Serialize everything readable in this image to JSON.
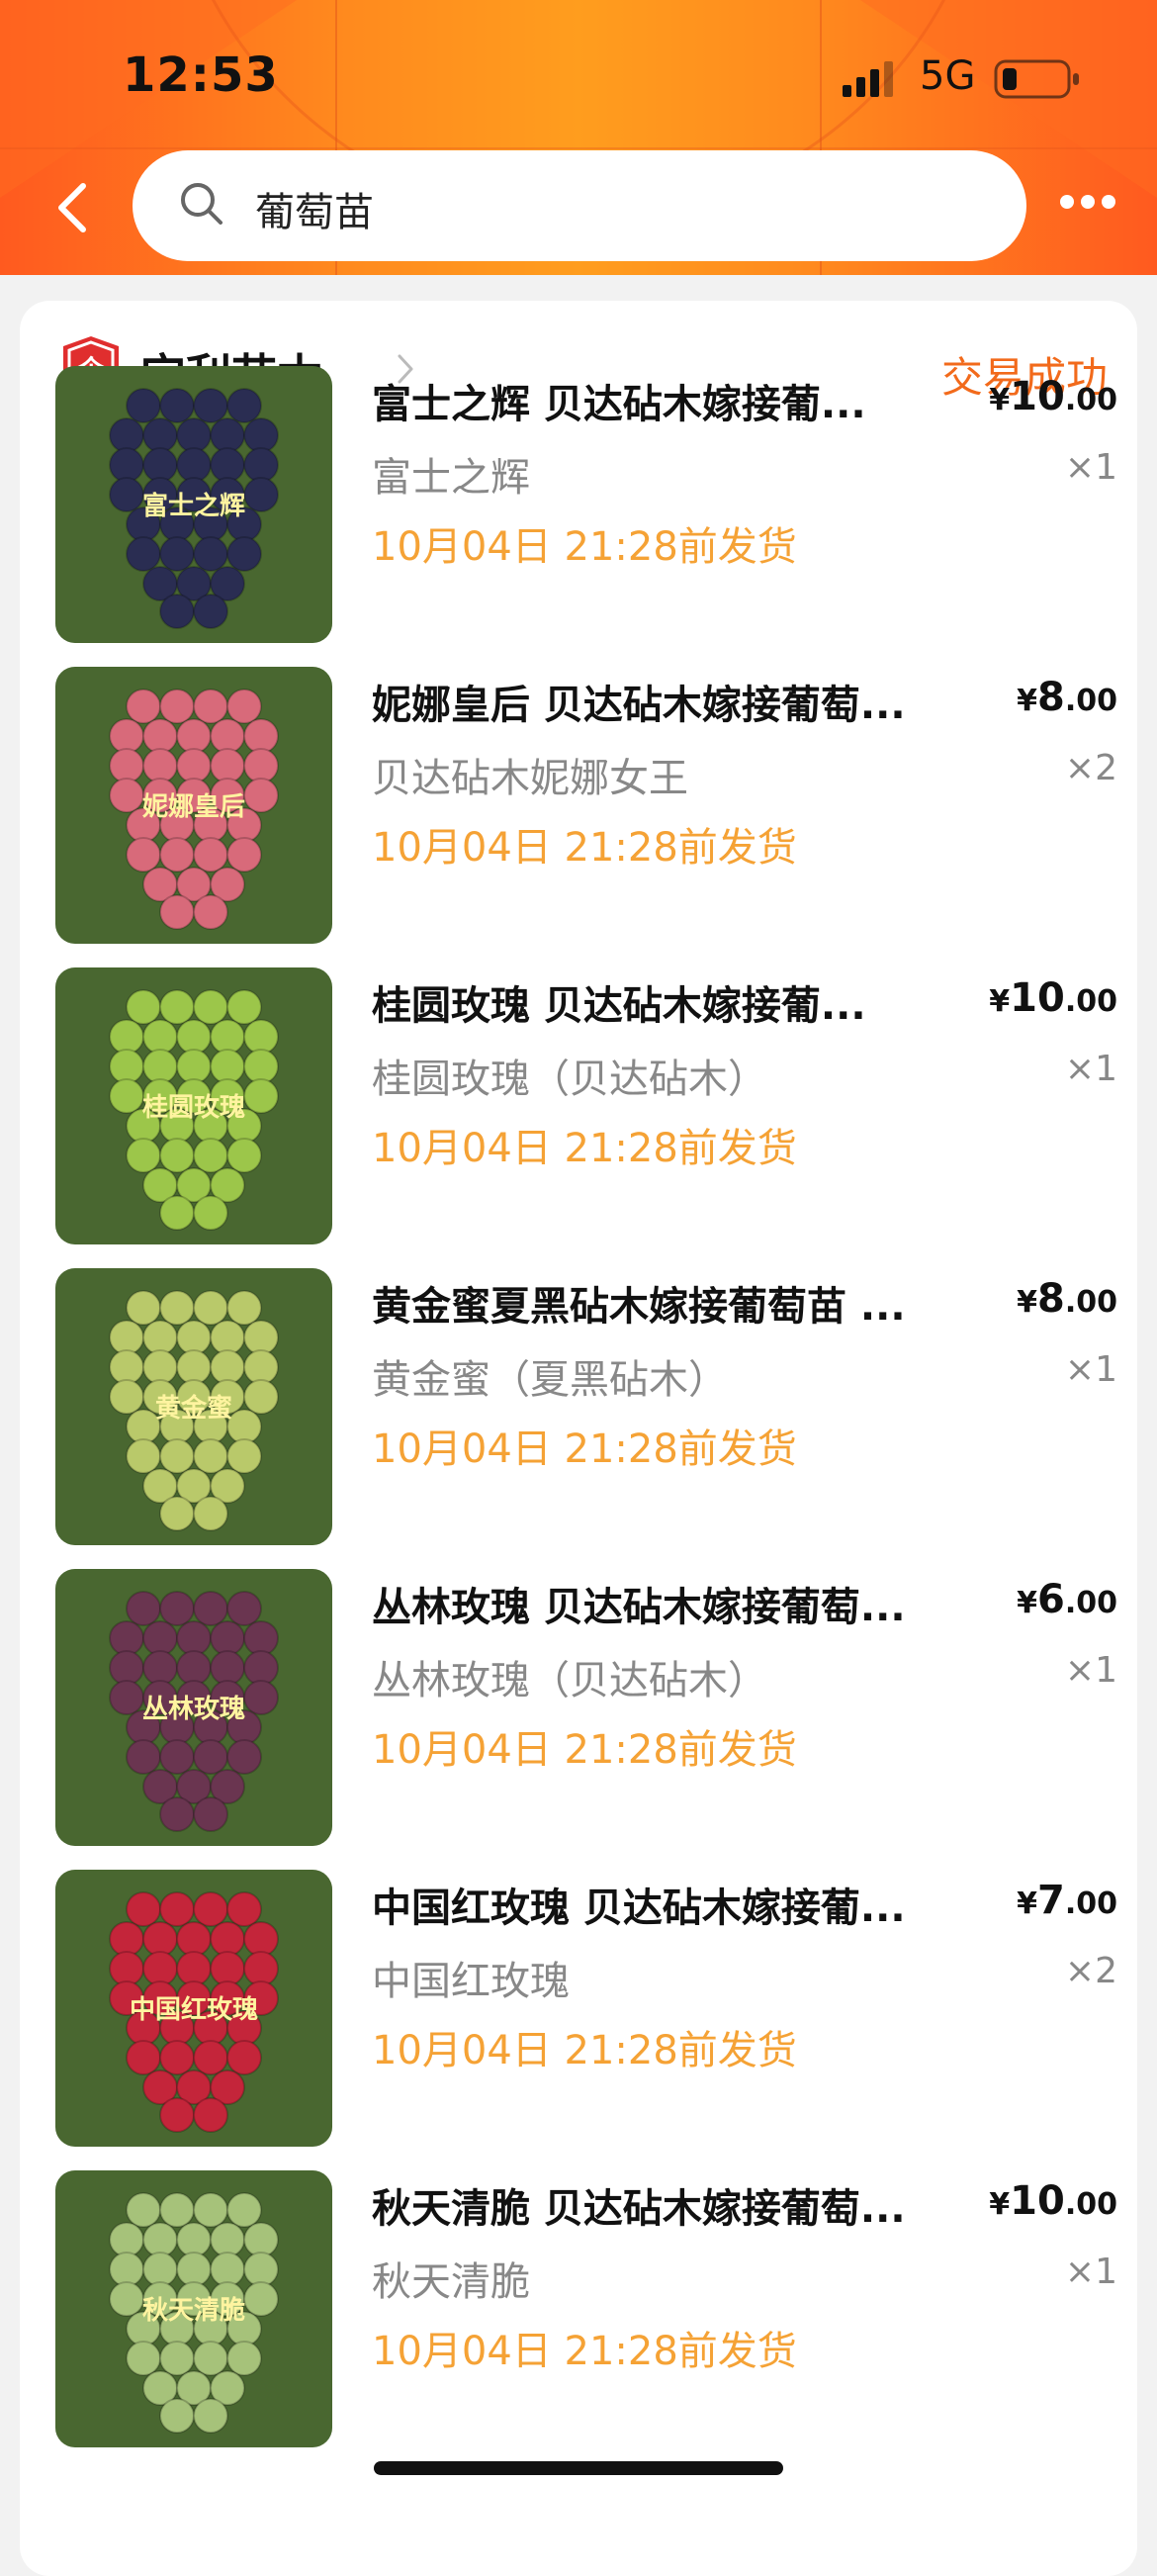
{
  "status_bar": {
    "time": "12:53",
    "network": "5G"
  },
  "search": {
    "query": "葡萄苗"
  },
  "shop": {
    "name": "宝利苗木",
    "order_status": "交易成功",
    "badge_text": "企"
  },
  "items": [
    {
      "title": "富士之辉  贝达砧木嫁接葡...",
      "sku": "富士之辉",
      "price_currency": "¥",
      "price_int": "10",
      "price_dec": ".00",
      "qty": "×1",
      "ship": "10月04日 21:28前发货",
      "image_label": "富士之辉",
      "image_color": "#2a2d52"
    },
    {
      "title": "妮娜皇后 贝达砧木嫁接葡萄...",
      "sku": "贝达砧木妮娜女王",
      "price_currency": "¥",
      "price_int": "8",
      "price_dec": ".00",
      "qty": "×2",
      "ship": "10月04日 21:28前发货",
      "image_label": "妮娜皇后",
      "image_color": "#d86a7a"
    },
    {
      "title": "桂圆玫瑰  贝达砧木嫁接葡...",
      "sku": "桂圆玫瑰（贝达砧木）",
      "price_currency": "¥",
      "price_int": "10",
      "price_dec": ".00",
      "qty": "×1",
      "ship": "10月04日 21:28前发货",
      "image_label": "桂圆玫瑰",
      "image_color": "#9cc64a"
    },
    {
      "title": "黄金蜜夏黑砧木嫁接葡萄苗 ...",
      "sku": "黄金蜜（夏黑砧木）",
      "price_currency": "¥",
      "price_int": "8",
      "price_dec": ".00",
      "qty": "×1",
      "ship": "10月04日 21:28前发货",
      "image_label": "黄金蜜",
      "image_color": "#b9c96a"
    },
    {
      "title": "丛林玫瑰  贝达砧木嫁接葡萄...",
      "sku": "丛林玫瑰（贝达砧木）",
      "price_currency": "¥",
      "price_int": "6",
      "price_dec": ".00",
      "qty": "×1",
      "ship": "10月04日 21:28前发货",
      "image_label": "丛林玫瑰",
      "image_color": "#6a3550"
    },
    {
      "title": "中国红玫瑰 贝达砧木嫁接葡...",
      "sku": "中国红玫瑰",
      "price_currency": "¥",
      "price_int": "7",
      "price_dec": ".00",
      "qty": "×2",
      "ship": "10月04日 21:28前发货",
      "image_label": "中国红玫瑰",
      "image_color": "#c4253a"
    },
    {
      "title": "秋天清脆 贝达砧木嫁接葡萄...",
      "sku": "秋天清脆",
      "price_currency": "¥",
      "price_int": "10",
      "price_dec": ".00",
      "qty": "×1",
      "ship": "10月04日 21:28前发货",
      "image_label": "秋天清脆",
      "image_color": "#a6c27a"
    }
  ],
  "colors": {
    "accent": "#f26a1b",
    "ship_text": "#f5a235",
    "header": "#ff8a1e"
  }
}
